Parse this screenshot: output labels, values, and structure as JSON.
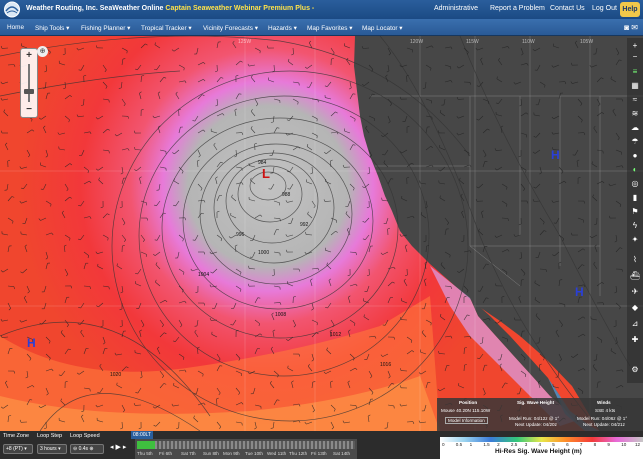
{
  "header": {
    "brand": "Weather Routing, Inc. SeaWeather Online",
    "brand_highlight": "Captain Seaweather Webinar Premium Plus -",
    "links": [
      "Administrative",
      "Report a Problem",
      "Contact Us",
      "Log Out"
    ],
    "help": "Help"
  },
  "nav": {
    "items": [
      "Home",
      "Ship Tools",
      "Fishing Planner",
      "Tropical Tracker",
      "Vicinity Forecasts",
      "Hazards",
      "Map Favorites",
      "Map Locator"
    ]
  },
  "map": {
    "low_label": "L",
    "high_label": "H",
    "longitude_labels": [
      "125W",
      "120W",
      "115W",
      "110W",
      "105W"
    ],
    "isobar_labels": [
      "984",
      "988",
      "992",
      "996",
      "1000",
      "1004",
      "1008",
      "1012",
      "1016",
      "1020"
    ],
    "colors": {
      "ocean_high": "#f23a3a",
      "ocean_mid": "#ff6f3a",
      "ocean_low": "#ffb54a",
      "storm_core": "#b9b9b9",
      "storm_ring": "#e86ad8",
      "land": "#474747"
    }
  },
  "info": {
    "position_header": "Position",
    "position_value": "Mouse 40.20N 115.10W",
    "model_info": "Model Information",
    "wave_header": "Sig. Wave Height",
    "wave_model": "Model Run: 04/12z @ 1°",
    "wave_update": "Next Update: 04/20z",
    "winds_header": "Winds",
    "winds_value": "SSE 4 kts",
    "winds_model": "Model Run: 04/06z @ 1°",
    "winds_update": "Next Update: 04/21z"
  },
  "bottom": {
    "timezone_label": "Time Zone",
    "timezone_value": "+8 (PT)",
    "loopstep_label": "Loop Step",
    "loopstep_value": "3 hours",
    "loopspeed_label": "Loop Speed",
    "loopspeed_value": "0.4s",
    "current_time": "08:00LT",
    "days": [
      "Thu 5th",
      "Fri 6th",
      "Sat 7th",
      "Sun 8th",
      "Mon 9th",
      "Tue 10th",
      "Wed 11th",
      "Thu 12th",
      "Fri 13th",
      "Sat 14th"
    ],
    "legend_ticks": [
      "0",
      "0.5",
      "1",
      "1.5",
      "2",
      "2.5",
      "3",
      "4",
      "5",
      "6",
      "7",
      "8",
      "9",
      "10",
      "12"
    ],
    "legend_title": "Hi-Res Sig. Wave Height (m)"
  }
}
